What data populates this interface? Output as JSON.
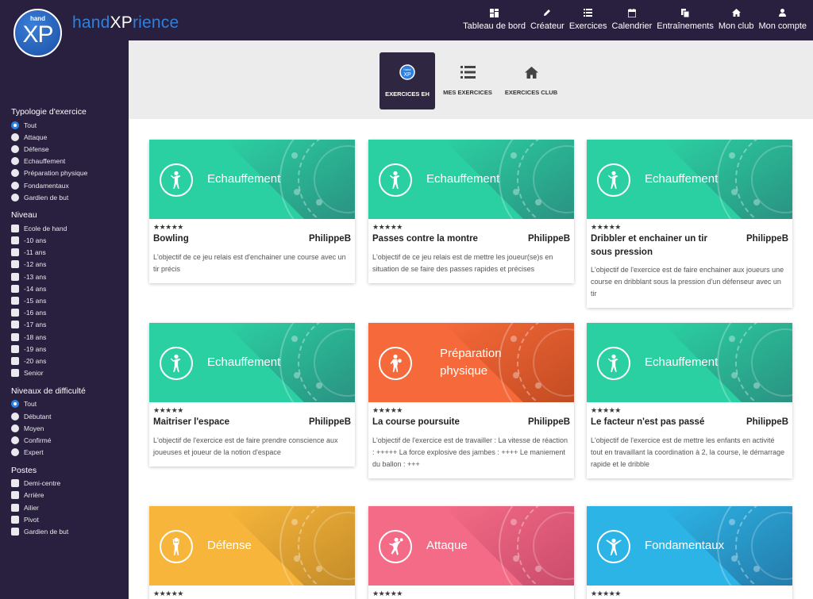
{
  "brand": {
    "prefix": "hand",
    "accent": "XP",
    "suffix": "rience",
    "logo_small": "hand",
    "logo_big": "XP"
  },
  "nav": [
    {
      "label": "Tableau de bord",
      "icon": "dashboard-icon"
    },
    {
      "label": "Créateur",
      "icon": "pencil-icon"
    },
    {
      "label": "Exercices",
      "icon": "list-icon"
    },
    {
      "label": "Calendrier",
      "icon": "calendar-icon"
    },
    {
      "label": "Entraînements",
      "icon": "copy-icon"
    },
    {
      "label": "Mon club",
      "icon": "home-icon"
    },
    {
      "label": "Mon compte",
      "icon": "user-icon"
    }
  ],
  "filters": {
    "typologie": {
      "title": "Typologie d'exercice",
      "options": [
        "Tout",
        "Attaque",
        "Défense",
        "Echauffement",
        "Préparation physique",
        "Fondamentaux",
        "Gardien de but"
      ],
      "selected": 0
    },
    "niveau": {
      "title": "Niveau",
      "options": [
        "Ecole de hand",
        "-10 ans",
        "-11 ans",
        "-12 ans",
        "-13 ans",
        "-14 ans",
        "-15 ans",
        "-16 ans",
        "-17 ans",
        "-18 ans",
        "-19 ans",
        "-20 ans",
        "Senior"
      ]
    },
    "difficulte": {
      "title": "Niveaux de difficulté",
      "options": [
        "Tout",
        "Débutant",
        "Moyen",
        "Confirmé",
        "Expert"
      ],
      "selected": 0
    },
    "postes": {
      "title": "Postes",
      "options": [
        "Demi-centre",
        "Arrière",
        "Ailier",
        "Pivot",
        "Gardien de but"
      ]
    }
  },
  "tabs": [
    {
      "label": "EXERCICES EH",
      "icon": "handxp-logo-icon",
      "active": true
    },
    {
      "label": "MES EXERCICES",
      "icon": "list-icon",
      "active": false
    },
    {
      "label": "EXERCICES CLUB",
      "icon": "home-icon",
      "active": false
    }
  ],
  "colors": {
    "echauffement": [
      "#2bd0a2",
      "#2a8f80"
    ],
    "preparation": [
      "#f5693a",
      "#c04a20"
    ],
    "defense": [
      "#f7b63b",
      "#c28a28"
    ],
    "attaque": [
      "#f36b86",
      "#c94a6a"
    ],
    "fondamentaux": [
      "#2db4e6",
      "#2379a8"
    ]
  },
  "cards": [
    {
      "category": "Echauffement",
      "theme": "echauffement",
      "stars": "★★★★★",
      "title": "Bowling",
      "author": "PhilippeB",
      "description": "L'objectif de ce jeu relais est d'enchainer une course avec un tir précis"
    },
    {
      "category": "Echauffement",
      "theme": "echauffement",
      "stars": "★★★★★",
      "title": "Passes contre la montre",
      "author": "PhilippeB",
      "description": "L'objectif de ce jeu relais est de mettre les joueur(se)s en situation de se faire des passes rapides et précises"
    },
    {
      "category": "Echauffement",
      "theme": "echauffement",
      "stars": "★★★★★",
      "title": "Dribbler et enchainer un tir sous pression",
      "author": "PhilippeB",
      "description": "L'objectif de l'exercice est de faire enchainer aux joueurs une course en dribblant sous la pression d'un défenseur avec un tir"
    },
    {
      "category": "Echauffement",
      "theme": "echauffement",
      "stars": "★★★★★",
      "title": "Maitriser l'espace",
      "author": "PhilippeB",
      "description": "L'objectif de l'exercice est de faire prendre conscience aux joueuses et joueur de la notion d'espace"
    },
    {
      "category": "Préparation physique",
      "theme": "preparation",
      "stars": "★★★★★",
      "title": "La course poursuite",
      "author": "PhilippeB",
      "description": "L'objectif de l'exercice est de travailler : La vitesse de réaction : +++++ La force explosive des jambes : ++++ Le maniement du ballon : +++"
    },
    {
      "category": "Echauffement",
      "theme": "echauffement",
      "stars": "★★★★★",
      "title": "Le facteur n'est pas passé",
      "author": "PhilippeB",
      "description": "L'objectif de l'exercice est de mettre les enfants en activité tout en travaillant la coordination à 2, la course, le démarrage rapide et le dribble"
    },
    {
      "category": "Défense",
      "theme": "defense",
      "stars": "★★★★★",
      "title": "",
      "author": "",
      "description": ""
    },
    {
      "category": "Attaque",
      "theme": "attaque",
      "stars": "★★★★★",
      "title": "",
      "author": "",
      "description": ""
    },
    {
      "category": "Fondamentaux",
      "theme": "fondamentaux",
      "stars": "★★★★★",
      "title": "",
      "author": "",
      "description": ""
    }
  ]
}
